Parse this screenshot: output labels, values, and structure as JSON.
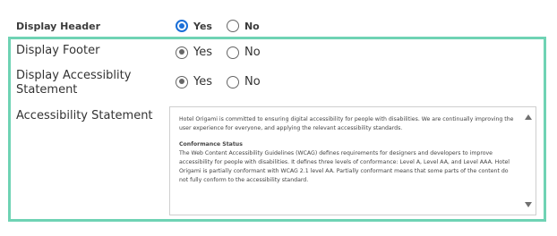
{
  "display_header": {
    "label": "Display Header",
    "options": [
      {
        "label": "Yes",
        "checked": true
      },
      {
        "label": "No",
        "checked": false
      }
    ]
  },
  "display_footer": {
    "label": "Display Footer",
    "options": [
      {
        "label": "Yes",
        "checked": true
      },
      {
        "label": "No",
        "checked": false
      }
    ]
  },
  "display_accessibility_statement": {
    "label_line1": "Display Accessiblity",
    "label_line2": "Statement",
    "options": [
      {
        "label": "Yes",
        "checked": true
      },
      {
        "label": "No",
        "checked": false
      }
    ]
  },
  "accessibility_statement": {
    "label": "Accessibility Statement",
    "paragraph1": "Hotel Origami  is committed to ensuring digital accessibility for people with disabilities. We are continually improving the user experience for everyone, and applying the relevant accessibility standards.",
    "heading": "Conformance Status",
    "paragraph2": "The Web Content Accessibility Guidelines (WCAG) defines requirements for designers and developers to improve accessibility for people with disabilities. It defines three levels of conformance: Level A, Level AA, and Level AAA. Hotel Origami is partially conformant with WCAG 2.1 level AA. Partially conformant means that some parts of the content do not fully conform to the accessibility standard."
  },
  "colors": {
    "highlight_border": "#6fd3b4",
    "header_radio_accent": "#1a6fd8",
    "radio_default": "#666666"
  }
}
